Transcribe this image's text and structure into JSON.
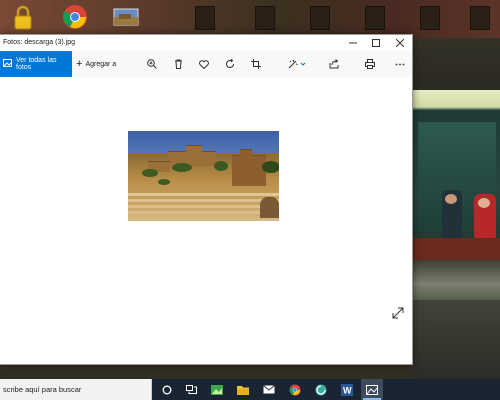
{
  "window": {
    "title": "Fotos: descarga (3).jpg",
    "minimize_icon": "minimize-icon",
    "maximize_icon": "maximize-icon",
    "close_icon": "close-icon"
  },
  "toolbar": {
    "view_all_label": "Ver todas las fotos",
    "add_to_label": "Agregar a",
    "tools": [
      "zoom-in-icon",
      "delete-icon",
      "favorite-icon",
      "rotate-icon",
      "crop-icon",
      "edit-icon",
      "share-icon",
      "print-icon",
      "more-icon"
    ]
  },
  "taskbar": {
    "search_placeholder": "scribe aquí para buscar",
    "apps": [
      "cortana-icon",
      "task-view-icon",
      "photos-app-icon",
      "file-explorer-icon",
      "mail-icon",
      "chrome-icon",
      "app-icon",
      "word-icon",
      "photos-viewer-icon"
    ]
  },
  "colors": {
    "accent": "#0078d7",
    "taskbar": "#1a2533"
  }
}
